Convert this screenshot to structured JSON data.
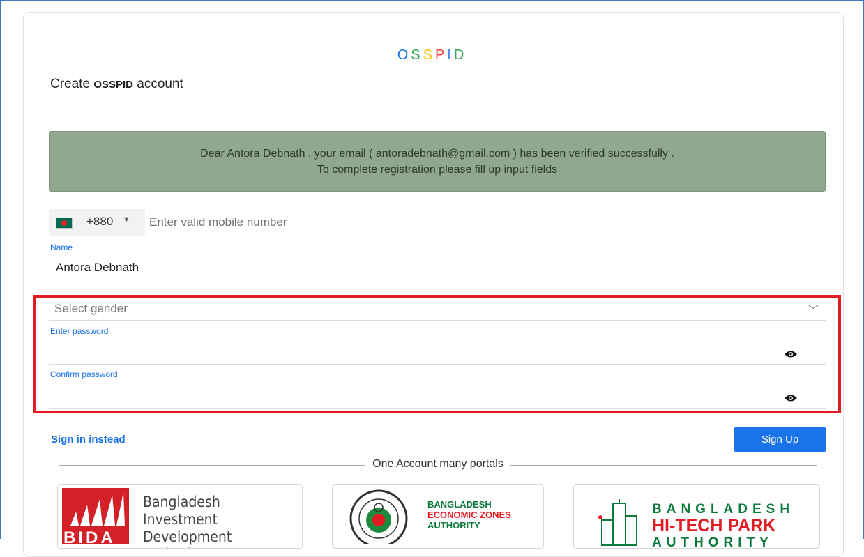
{
  "brand": {
    "letters": [
      "O",
      "S",
      "S",
      "P",
      "I",
      "D"
    ],
    "colors": [
      "#1a73e8",
      "#34a853",
      "#fbbc05",
      "#ea4335",
      "#4285f4",
      "#34a853"
    ]
  },
  "header": {
    "title_prefix": "Create ",
    "title_bold": "OSSPID",
    "title_suffix": " account"
  },
  "alert": {
    "line1": "Dear Antora Debnath , your email ( antoradebnath@gmail.com ) has been verified successfully .",
    "line2": "To complete registration please fill up input fields"
  },
  "form": {
    "phone": {
      "country_code": "+880",
      "placeholder": "Enter valid mobile number",
      "flag": "bangladesh-flag"
    },
    "name": {
      "label": "Name",
      "value": "Antora Debnath"
    },
    "gender": {
      "placeholder": "Select gender"
    },
    "password": {
      "label": "Enter password"
    },
    "confirm_password": {
      "label": "Confirm password"
    }
  },
  "actions": {
    "signin_label": "Sign in instead",
    "signup_label": "Sign Up"
  },
  "portals": {
    "divider_label": "One Account many portals",
    "bida": {
      "line1": "Bangladesh Investment",
      "line2": "Development Authority",
      "logo_word": "BIDA"
    },
    "beza": {
      "line1": "BANGLADESH",
      "line2": "ECONOMIC ZONES",
      "line3": "AUTHORITY"
    },
    "htpa": {
      "line1": "BANGLADESH",
      "line2": "HI-TECH PARK",
      "line3": "AUTHORITY"
    }
  },
  "colors": {
    "accent": "#1a73e8",
    "alert_bg": "#8fa88e",
    "highlight": "#e31b23"
  }
}
